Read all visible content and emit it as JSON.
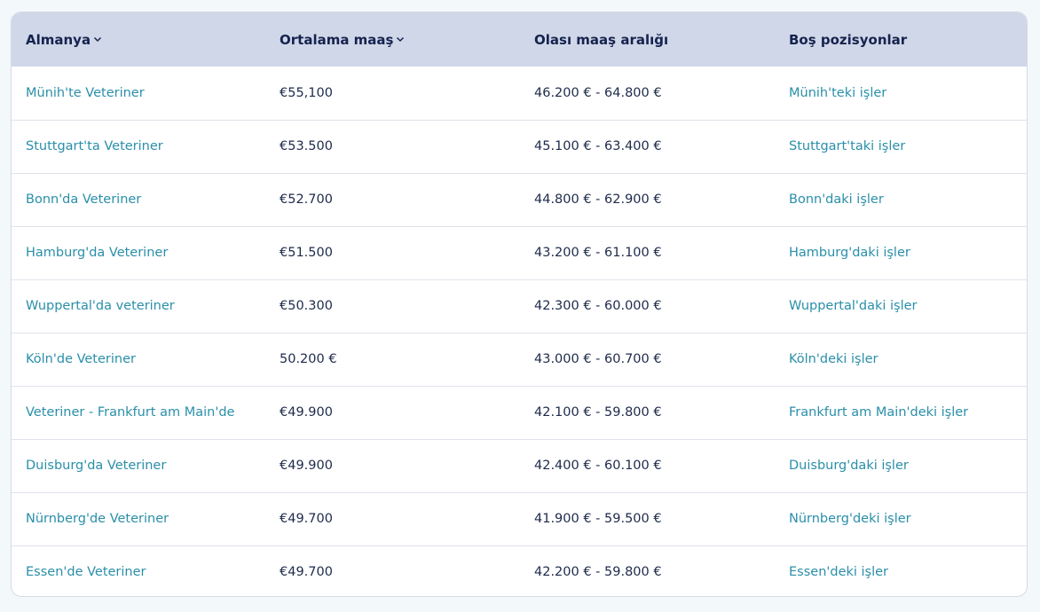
{
  "table": {
    "headers": [
      {
        "label": "Almanya",
        "sortable": true
      },
      {
        "label": "Ortalama maaş",
        "sortable": true
      },
      {
        "label": "Olası maaş aralığı",
        "sortable": false
      },
      {
        "label": "Boş pozisyonlar",
        "sortable": false
      }
    ],
    "rows": [
      {
        "city": "Münih'te Veteriner",
        "avg": "€55,100",
        "range": "46.200 € - 64.800 €",
        "jobs": "Münih'teki işler"
      },
      {
        "city": "Stuttgart'ta Veteriner",
        "avg": "€53.500",
        "range": "45.100 € - 63.400 €",
        "jobs": "Stuttgart'taki işler"
      },
      {
        "city": "Bonn'da Veteriner",
        "avg": "€52.700",
        "range": "44.800 € - 62.900 €",
        "jobs": "Bonn'daki işler"
      },
      {
        "city": "Hamburg'da Veteriner",
        "avg": "€51.500",
        "range": "43.200 € - 61.100 €",
        "jobs": "Hamburg'daki işler"
      },
      {
        "city": "Wuppertal'da veteriner",
        "avg": "€50.300",
        "range": "42.300 € - 60.000 €",
        "jobs": "Wuppertal'daki işler"
      },
      {
        "city": "Köln'de Veteriner",
        "avg": "50.200 €",
        "range": "43.000 € - 60.700 €",
        "jobs": "Köln'deki işler"
      },
      {
        "city": "Veteriner - Frankfurt am Main'de",
        "avg": "€49.900",
        "range": "42.100 € - 59.800 €",
        "jobs": "Frankfurt am Main'deki işler"
      },
      {
        "city": "Duisburg'da Veteriner",
        "avg": "€49.900",
        "range": "42.400 € - 60.100 €",
        "jobs": "Duisburg'daki işler"
      },
      {
        "city": "Nürnberg'de Veteriner",
        "avg": "€49.700",
        "range": "41.900 € - 59.500 €",
        "jobs": "Nürnberg'deki işler"
      },
      {
        "city": "Essen'de Veteriner",
        "avg": "€49.700",
        "range": "42.200 € - 59.800 €",
        "jobs": "Essen'deki işler"
      }
    ]
  },
  "colors": {
    "header_bg": "#d0d7e8",
    "header_text": "#15234f",
    "link": "#2a8fa9",
    "value_text": "#1d2a4a"
  },
  "icons": {
    "sort": "chevron-down-icon"
  }
}
